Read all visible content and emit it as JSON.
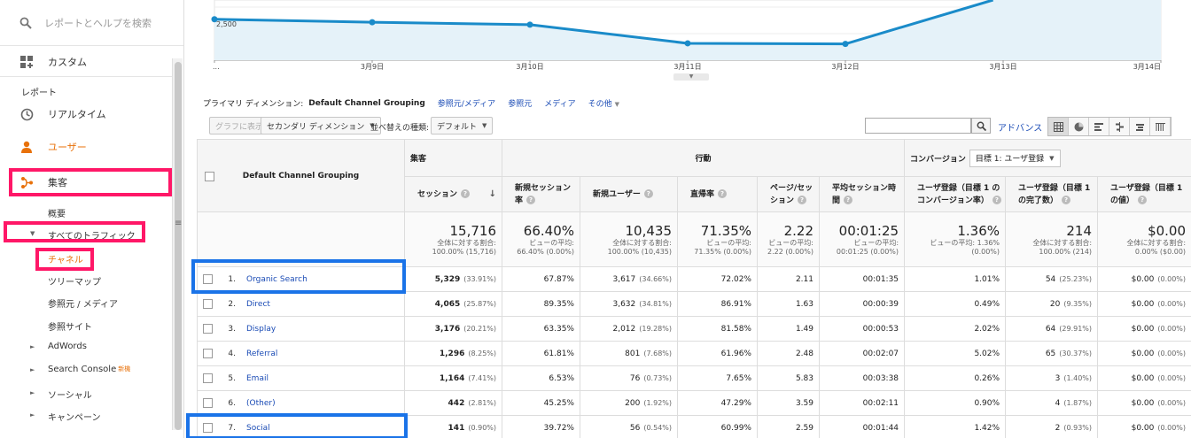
{
  "sidebar": {
    "search_placeholder": "レポートとヘルプを検索",
    "custom": "カスタム",
    "reports_label": "レポート",
    "realtime": "リアルタイム",
    "users": "ユーザー",
    "acquisition": "集客",
    "overview": "概要",
    "all_traffic": "すべてのトラフィック",
    "channels": "チャネル",
    "treemap": "ツリーマップ",
    "source_medium": "参照元 / メディア",
    "referrals": "参照サイト",
    "adwords": "AdWords",
    "search_console": "Search Console",
    "new_badge": "新機",
    "social": "ソーシャル",
    "campaigns": "キャンペーン",
    "accent_color": "#e8710a"
  },
  "chart_data": {
    "type": "line",
    "x": [
      "",
      "3月9日",
      "3月10日",
      "3月11日",
      "3月12日",
      "3月13日",
      "3月14日"
    ],
    "tick_labels": [
      "...",
      "3月9日",
      "3月10日",
      "3月11日",
      "3月12日",
      "3月13日",
      "3月14日"
    ],
    "values": [
      2580,
      2530,
      2490,
      2180,
      2170,
      2950,
      null
    ],
    "y_tick_label": "2,500",
    "ylim": [
      1900,
      2900
    ],
    "grid": true,
    "line_color": "#1a8bc9",
    "fill_color": "#e5f2f9"
  },
  "dimensions": {
    "label": "プライマリ ディメンション:",
    "current": "Default Channel Grouping",
    "links": [
      "参照元/メディア",
      "参照元",
      "メディア",
      "その他"
    ]
  },
  "toolbar": {
    "plot_rows": "グラフに表示",
    "secondary_dimension": "セカンダリ ディメンション",
    "sort_type_label": "並べ替えの種類:",
    "sort_default": "デフォルト",
    "advanced": "アドバンス"
  },
  "table": {
    "dim_header": "Default Channel Grouping",
    "group_acquisition": "集客",
    "group_behavior": "行動",
    "group_conversion": "コンバージョン",
    "goal_select": "目標 1: ユーザ登録",
    "columns": [
      "セッション",
      "新規セッション率",
      "新規ユーザー",
      "直帰率",
      "ページ/セッション",
      "平均セッション時間",
      "ユーザ登録（目標 1 の コンバージョン率）",
      "ユーザ登録（目標 1 の完了数）",
      "ユーザ登録（目標 1 の値）"
    ],
    "totals": [
      {
        "big": "15,716",
        "l1": "全体に対する割合:",
        "l2": "100.00% (15,716)"
      },
      {
        "big": "66.40%",
        "l1": "ビューの平均:",
        "l2": "66.40% (0.00%)"
      },
      {
        "big": "10,435",
        "l1": "全体に対する割合:",
        "l2": "100.00% (10,435)"
      },
      {
        "big": "71.35%",
        "l1": "ビューの平均:",
        "l2": "71.35% (0.00%)"
      },
      {
        "big": "2.22",
        "l1": "ビューの平均:",
        "l2": "2.22 (0.00%)"
      },
      {
        "big": "00:01:25",
        "l1": "ビューの平均:",
        "l2": "00:01:25 (0.00%)"
      },
      {
        "big": "1.36%",
        "l1": "ビューの平均: 1.36%",
        "l2": "(0.00%)"
      },
      {
        "big": "214",
        "l1": "全体に対する割合:",
        "l2": "100.00% (214)"
      },
      {
        "big": "$0.00",
        "l1": "全体に対する割合:",
        "l2": "0.00% ($0.00)"
      }
    ],
    "rows": [
      {
        "num": "1.",
        "name": "Organic Search",
        "sessions": "5,329",
        "sp": "(33.91%)",
        "nsr": "67.87%",
        "nu": "3,617",
        "nup": "(34.66%)",
        "br": "72.02%",
        "pps": "2.11",
        "asd": "00:01:35",
        "cr": "1.01%",
        "comp": "54",
        "compp": "(25.23%)",
        "val": "$0.00",
        "valp": "(0.00%)"
      },
      {
        "num": "2.",
        "name": "Direct",
        "sessions": "4,065",
        "sp": "(25.87%)",
        "nsr": "89.35%",
        "nu": "3,632",
        "nup": "(34.81%)",
        "br": "86.91%",
        "pps": "1.63",
        "asd": "00:00:39",
        "cr": "0.49%",
        "comp": "20",
        "compp": "(9.35%)",
        "val": "$0.00",
        "valp": "(0.00%)"
      },
      {
        "num": "3.",
        "name": "Display",
        "sessions": "3,176",
        "sp": "(20.21%)",
        "nsr": "63.35%",
        "nu": "2,012",
        "nup": "(19.28%)",
        "br": "81.58%",
        "pps": "1.49",
        "asd": "00:00:53",
        "cr": "2.02%",
        "comp": "64",
        "compp": "(29.91%)",
        "val": "$0.00",
        "valp": "(0.00%)"
      },
      {
        "num": "4.",
        "name": "Referral",
        "sessions": "1,296",
        "sp": "(8.25%)",
        "nsr": "61.81%",
        "nu": "801",
        "nup": "(7.68%)",
        "br": "61.96%",
        "pps": "2.48",
        "asd": "00:02:07",
        "cr": "5.02%",
        "comp": "65",
        "compp": "(30.37%)",
        "val": "$0.00",
        "valp": "(0.00%)"
      },
      {
        "num": "5.",
        "name": "Email",
        "sessions": "1,164",
        "sp": "(7.41%)",
        "nsr": "6.53%",
        "nu": "76",
        "nup": "(0.73%)",
        "br": "7.65%",
        "pps": "5.83",
        "asd": "00:03:38",
        "cr": "0.26%",
        "comp": "3",
        "compp": "(1.40%)",
        "val": "$0.00",
        "valp": "(0.00%)"
      },
      {
        "num": "6.",
        "name": "(Other)",
        "sessions": "442",
        "sp": "(2.81%)",
        "nsr": "45.25%",
        "nu": "200",
        "nup": "(1.92%)",
        "br": "47.29%",
        "pps": "3.59",
        "asd": "00:02:11",
        "cr": "0.90%",
        "comp": "4",
        "compp": "(1.87%)",
        "val": "$0.00",
        "valp": "(0.00%)"
      },
      {
        "num": "7.",
        "name": "Social",
        "sessions": "141",
        "sp": "(0.90%)",
        "nsr": "39.72%",
        "nu": "56",
        "nup": "(0.54%)",
        "br": "60.99%",
        "pps": "2.59",
        "asd": "00:01:44",
        "cr": "1.42%",
        "comp": "2",
        "compp": "(0.93%)",
        "val": "$0.00",
        "valp": "(0.00%)"
      }
    ]
  }
}
